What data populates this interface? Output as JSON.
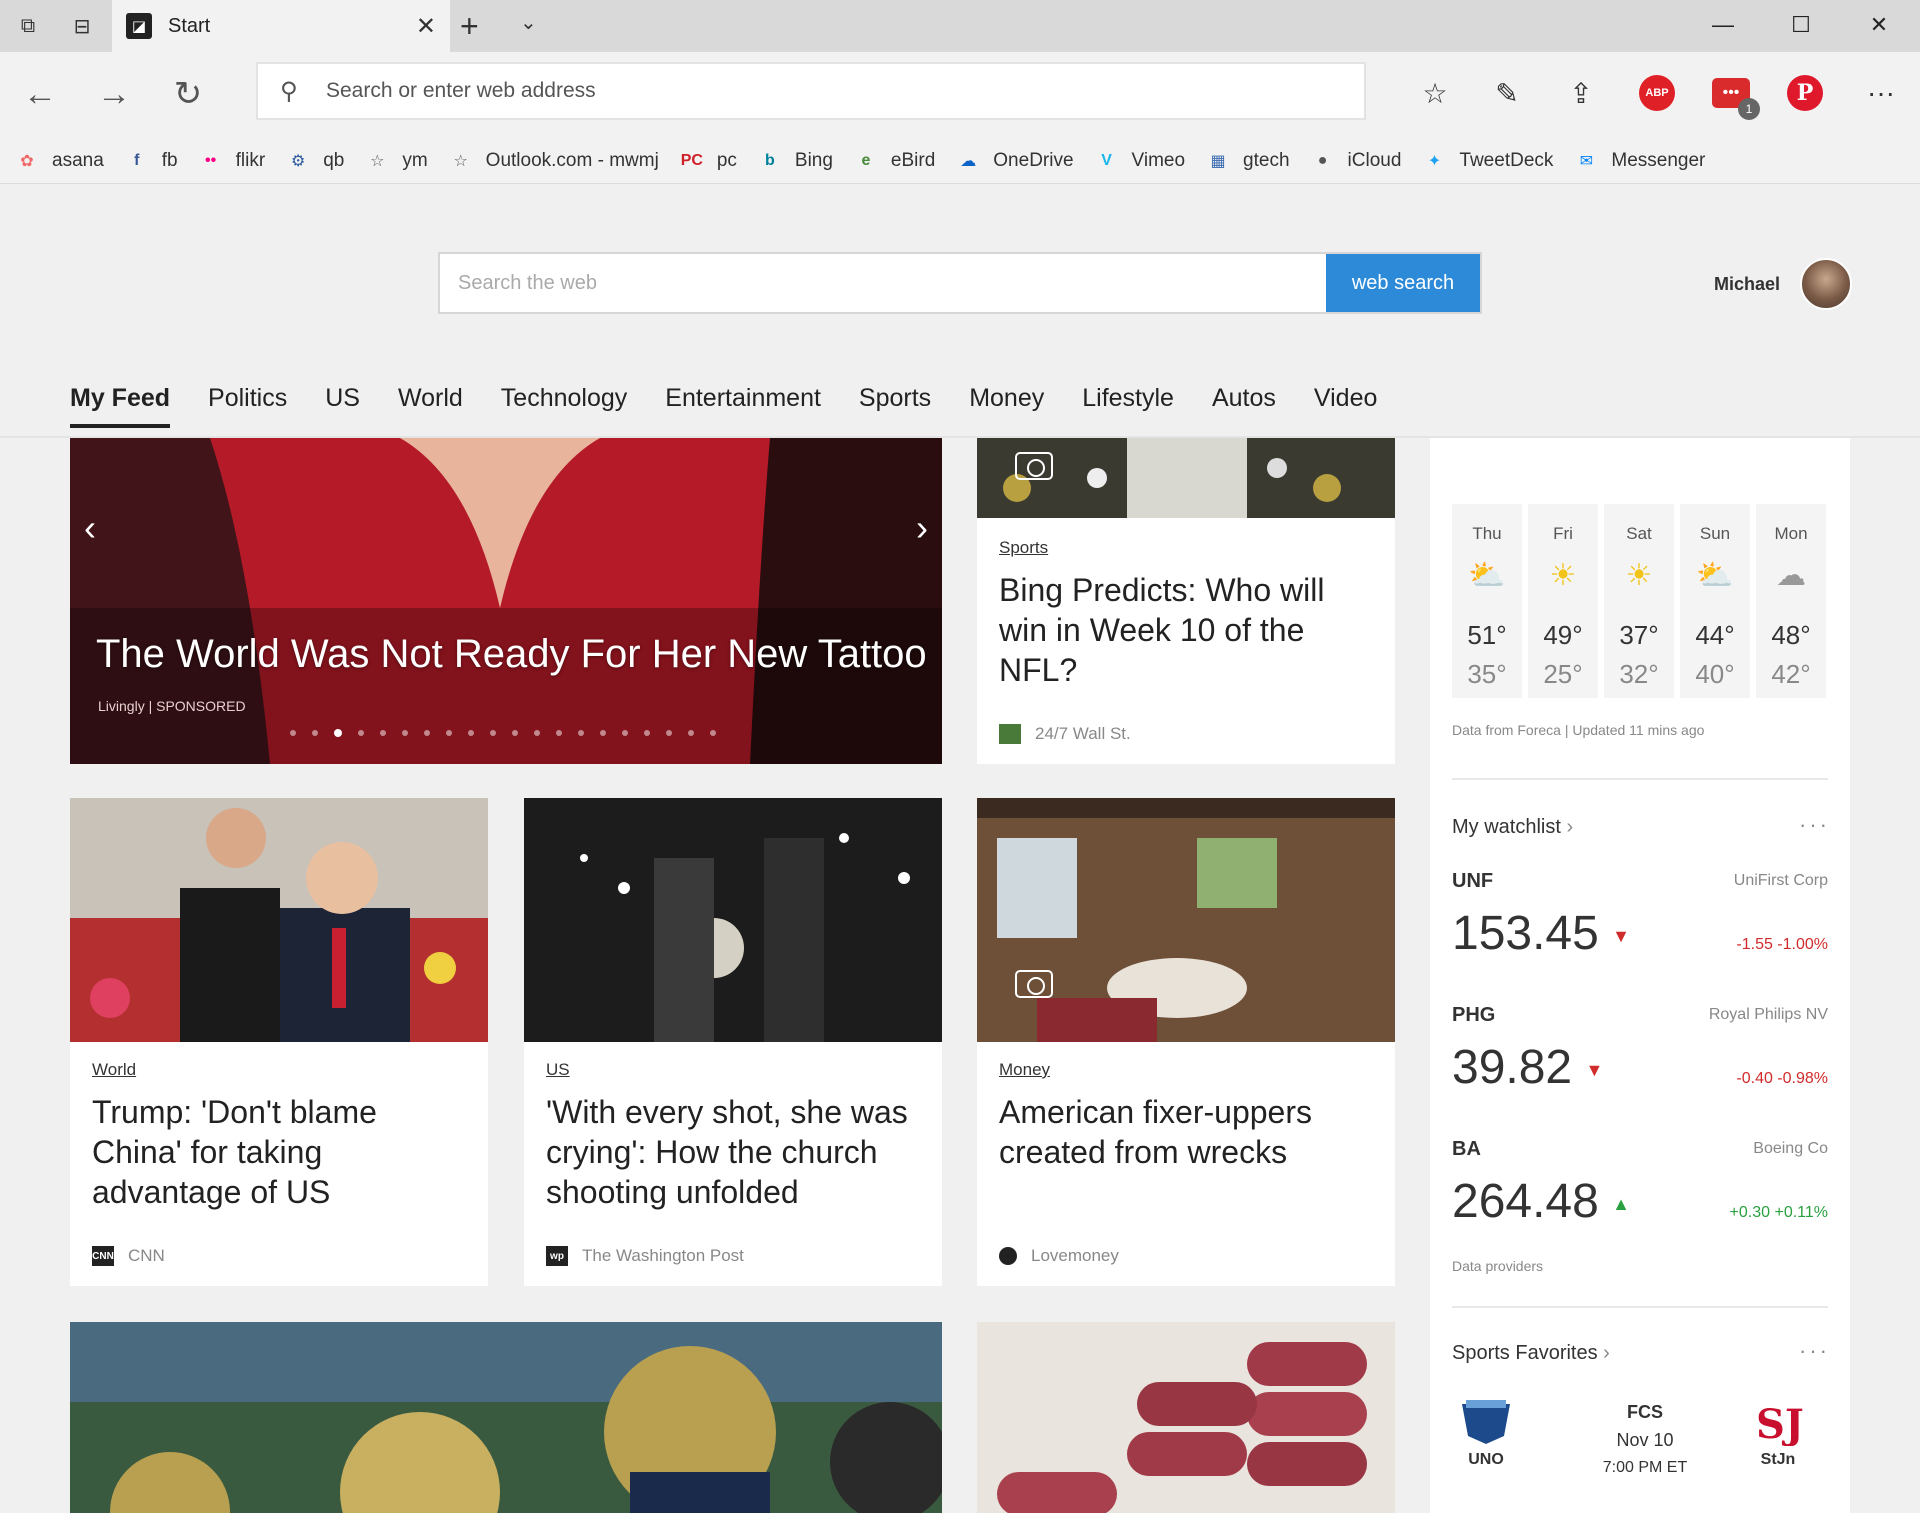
{
  "browser": {
    "tab_title": "Start",
    "address_placeholder": "Search or enter web address",
    "badge_count": "1",
    "abp_label": "ABP"
  },
  "favorites": [
    {
      "label": "asana",
      "icon": "asana-icon",
      "color": "#f06a6a",
      "glyph": "✿"
    },
    {
      "label": "fb",
      "icon": "facebook-icon",
      "color": "#3b5998",
      "glyph": "f"
    },
    {
      "label": "flikr",
      "icon": "flickr-icon",
      "color": "#ff0084",
      "glyph": "••"
    },
    {
      "label": "qb",
      "icon": "qb-icon",
      "color": "#2c5aa0",
      "glyph": "⚙"
    },
    {
      "label": "ym",
      "icon": "star-icon",
      "color": "#555555",
      "glyph": "☆"
    },
    {
      "label": "Outlook.com - mwmj",
      "icon": "star-icon",
      "color": "#555555",
      "glyph": "☆"
    },
    {
      "label": "pc",
      "icon": "pcmag-icon",
      "color": "#d0202a",
      "glyph": "PC"
    },
    {
      "label": "Bing",
      "icon": "bing-icon",
      "color": "#00809d",
      "glyph": "b"
    },
    {
      "label": "eBird",
      "icon": "ebird-icon",
      "color": "#4a8a3c",
      "glyph": "e"
    },
    {
      "label": "OneDrive",
      "icon": "onedrive-icon",
      "color": "#0a64c8",
      "glyph": "☁"
    },
    {
      "label": "Vimeo",
      "icon": "vimeo-icon",
      "color": "#1ab7ea",
      "glyph": "V"
    },
    {
      "label": "gtech",
      "icon": "gtech-icon",
      "color": "#3a6ab0",
      "glyph": "▦"
    },
    {
      "label": "iCloud",
      "icon": "apple-icon",
      "color": "#555555",
      "glyph": "●"
    },
    {
      "label": "TweetDeck",
      "icon": "tweetdeck-icon",
      "color": "#1da1f2",
      "glyph": "✦"
    },
    {
      "label": "Messenger",
      "icon": "messenger-icon",
      "color": "#0084ff",
      "glyph": "✉"
    }
  ],
  "page": {
    "search_placeholder": "Search the web",
    "search_button": "web search",
    "user_name": "Michael"
  },
  "feed_tabs": [
    "My Feed",
    "Politics",
    "US",
    "World",
    "Technology",
    "Entertainment",
    "Sports",
    "Money",
    "Lifestyle",
    "Autos",
    "Video"
  ],
  "hero": {
    "title": "The World Was Not Ready For Her New Tattoo",
    "sponsor": "Livingly | SPONSORED",
    "slide_count": 20,
    "active_slide": 3
  },
  "cards": {
    "nfl": {
      "category": "Sports",
      "title": "Bing Predicts: Who will win in Week 10 of the NFL?",
      "source": "24/7 Wall St."
    },
    "trump": {
      "category": "World",
      "title": "Trump: 'Don't blame China' for taking advantage of US",
      "source": "CNN"
    },
    "church": {
      "category": "US",
      "title": "'With every shot, she was crying': How the church shooting unfolded",
      "source": "The Washington Post"
    },
    "fixer": {
      "category": "Money",
      "title": "American fixer-uppers created from wrecks",
      "source": "Lovemoney"
    }
  },
  "weather": {
    "days": [
      {
        "name": "Thu",
        "icon": "partly-cloudy-icon",
        "hi": "51°",
        "lo": "35°"
      },
      {
        "name": "Fri",
        "icon": "sunny-icon",
        "hi": "49°",
        "lo": "25°"
      },
      {
        "name": "Sat",
        "icon": "sunny-icon",
        "hi": "37°",
        "lo": "32°"
      },
      {
        "name": "Sun",
        "icon": "partly-cloudy-icon",
        "hi": "44°",
        "lo": "40°"
      },
      {
        "name": "Mon",
        "icon": "cloudy-icon",
        "hi": "48°",
        "lo": "42°"
      }
    ],
    "note": "Data from Foreca | Updated 11 mins ago"
  },
  "watchlist": {
    "title": "My watchlist",
    "stocks": [
      {
        "symbol": "UNF",
        "name": "UniFirst Corp",
        "price": "153.45",
        "change": "-1.55  -1.00%",
        "dir": "down"
      },
      {
        "symbol": "PHG",
        "name": "Royal Philips NV",
        "price": "39.82",
        "change": "-0.40  -0.98%",
        "dir": "down"
      },
      {
        "symbol": "BA",
        "name": "Boeing Co",
        "price": "264.48",
        "change": "+0.30  +0.11%",
        "dir": "up"
      }
    ],
    "note": "Data providers"
  },
  "sports": {
    "title": "Sports Favorites",
    "home": "UNO",
    "away": "StJn",
    "league": "FCS",
    "date": "Nov 10",
    "time": "7:00 PM ET"
  }
}
